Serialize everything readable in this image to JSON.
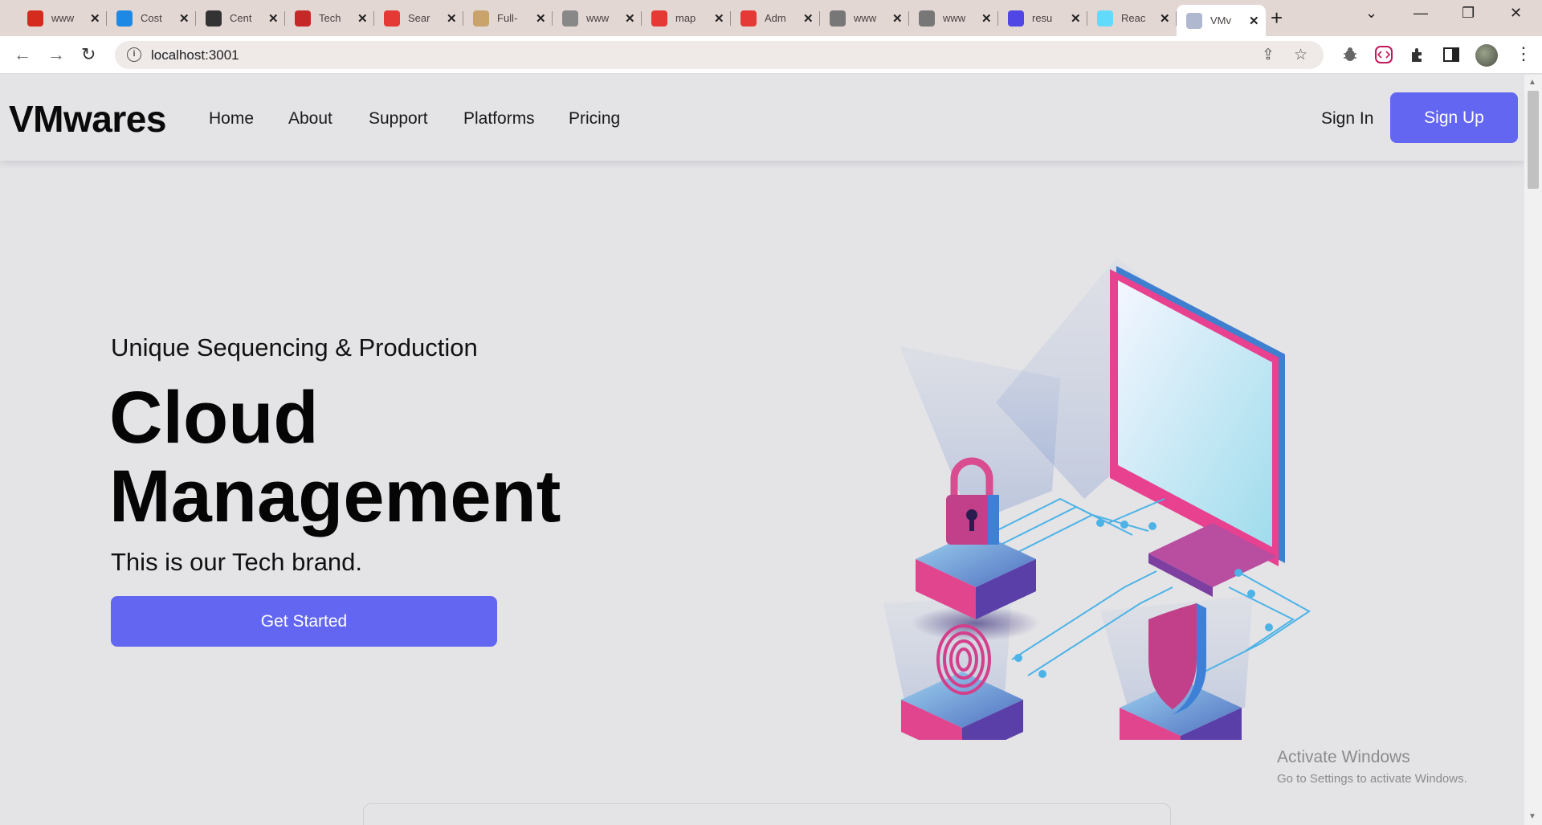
{
  "browser": {
    "tabs": [
      {
        "title": "www",
        "icon": "maple-leaf-icon",
        "color": "#d52b1e"
      },
      {
        "title": "Cost",
        "icon": "shield-logo-icon",
        "color": "#1e88e5"
      },
      {
        "title": "Cent",
        "icon": "c-logo-icon",
        "color": "#333333"
      },
      {
        "title": "Tech",
        "icon": "bars-logo-icon",
        "color": "#c62828"
      },
      {
        "title": "Sear",
        "icon": "s-logo-icon",
        "color": "#e53935"
      },
      {
        "title": "Full-",
        "icon": "c-outline-icon",
        "color": "#c9a36a"
      },
      {
        "title": "www",
        "icon": "google-icon",
        "color": "#888888"
      },
      {
        "title": "map",
        "icon": "red-globe-icon",
        "color": "#e53935"
      },
      {
        "title": "Adm",
        "icon": "red-globe-icon",
        "color": "#e53935"
      },
      {
        "title": "www",
        "icon": "doc-icon",
        "color": "#777777"
      },
      {
        "title": "www",
        "icon": "doc-icon",
        "color": "#777777"
      },
      {
        "title": "resu",
        "icon": "doc-spark-icon",
        "color": "#4f46e5"
      },
      {
        "title": "Reac",
        "icon": "react-icon",
        "color": "#61dafb"
      },
      {
        "title": "VMv",
        "icon": "globe-icon",
        "color": "#b0b8d0",
        "active": true
      }
    ],
    "url": "localhost:3001"
  },
  "site": {
    "brand": "VMwares",
    "nav": [
      "Home",
      "About",
      "Support",
      "Platforms",
      "Pricing"
    ],
    "sign_in": "Sign In",
    "sign_up": "Sign Up",
    "accent_color": "#6366f1"
  },
  "hero": {
    "eyebrow": "Unique Sequencing & Production",
    "headline_line1": "Cloud",
    "headline_line2": "Management",
    "tagline": "This is our Tech brand.",
    "cta": "Get Started",
    "illustration_icons": [
      "monitor-icon",
      "padlock-icon",
      "fingerprint-icon",
      "shield-icon"
    ]
  },
  "watermark": {
    "line1": "Activate Windows",
    "line2": "Go to Settings to activate Windows."
  }
}
